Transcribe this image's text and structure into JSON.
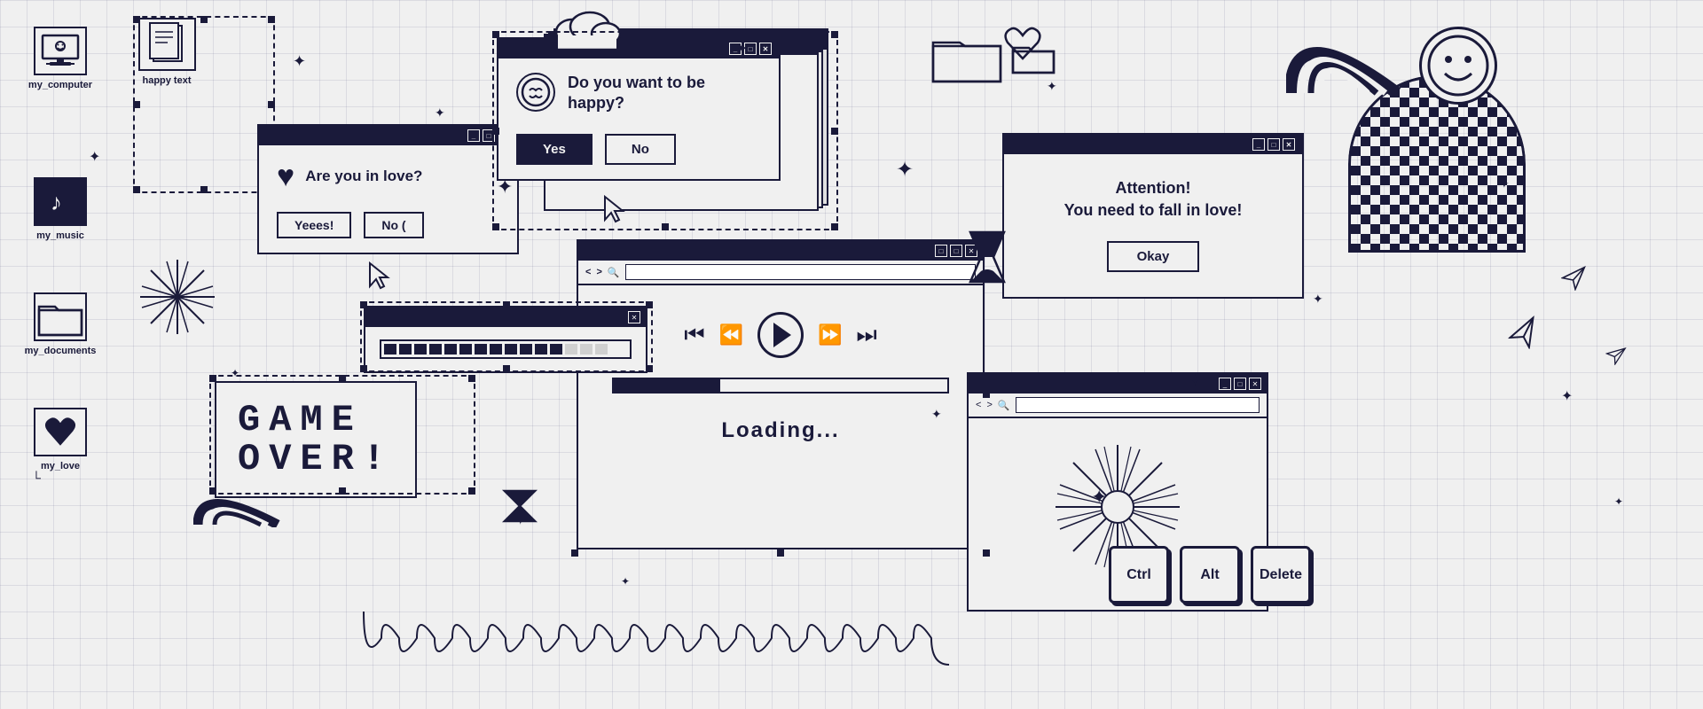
{
  "background": {
    "color": "#f0f0f0",
    "grid": true
  },
  "icons": {
    "my_computer": "my_computer",
    "happy_text": "happy text",
    "my_music": "my_music",
    "my_documents": "my_documents",
    "my_love": "my_love"
  },
  "dialog_love": {
    "question": "Are you in love?",
    "btn_yes": "Yeees!",
    "btn_no": "No ("
  },
  "dialog_happy": {
    "question": "Do you want to be happy?",
    "btn_yes": "Yes",
    "btn_no": "No"
  },
  "dialog_attention": {
    "title": "Attention!",
    "message": "Attention!\nYou need to fall in love!",
    "btn_ok": "Okay"
  },
  "game_over": {
    "line1": "GAME",
    "line2": "OVER!"
  },
  "media": {
    "loading_text": "Loading..."
  },
  "keyboard": {
    "ctrl": "Ctrl",
    "alt": "Alt",
    "delete": "Delete"
  },
  "progress_dialog": {
    "close_symbol": "✕"
  }
}
